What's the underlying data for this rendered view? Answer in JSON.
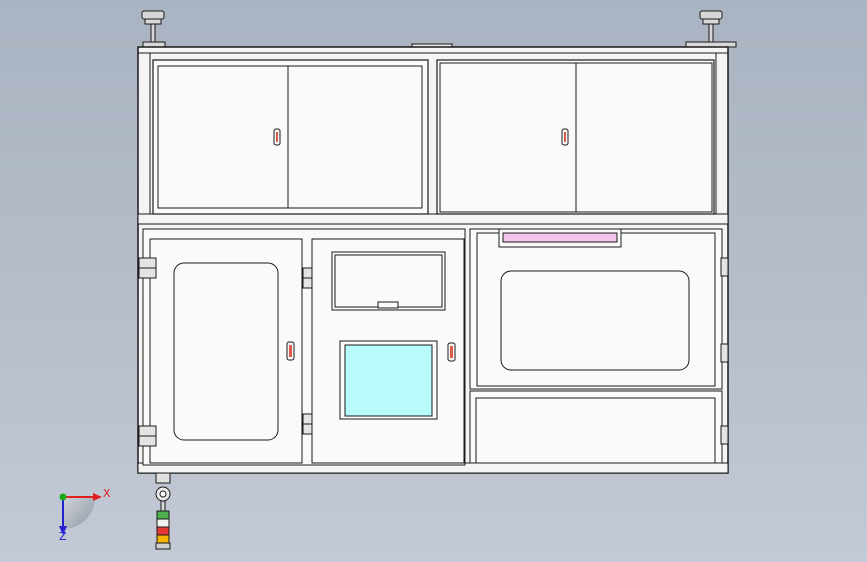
{
  "viewport": {
    "background_top": "#aab3c1",
    "background_bottom": "#c3cad6"
  },
  "colors": {
    "panel": "#fafafa",
    "line": "#1a1a1a",
    "screen": "#b8fbfb",
    "handle_red": "#e05a4a",
    "pink_bar": "#f2c6ea",
    "axis_x": "#e02020",
    "axis_y": "#2020d0",
    "axis_z_dot": "#1aa81a"
  },
  "axes": {
    "x_label": "X",
    "z_label": "Z"
  },
  "stack_light": {
    "segments": [
      "#4caf50",
      "#f2f2f2",
      "#e53935",
      "#f4b400"
    ]
  },
  "icons": [
    "handle-icon",
    "hinge-icon",
    "leveling-foot-icon",
    "stack-light-icon",
    "axis-triad-icon"
  ]
}
